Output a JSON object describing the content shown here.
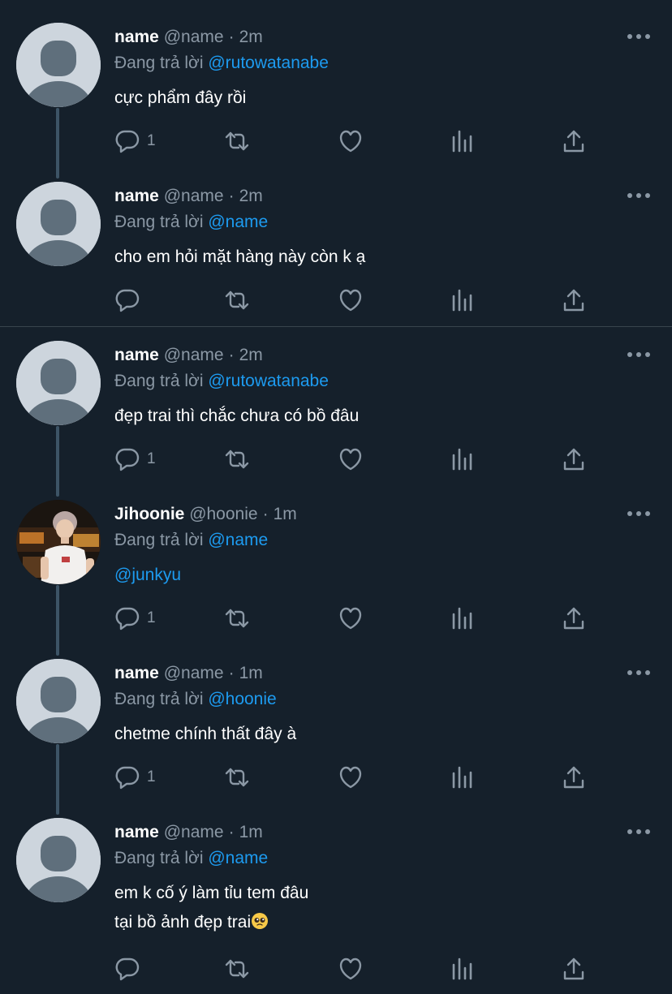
{
  "colors": {
    "background": "#15202b",
    "accent": "#1d9bf0",
    "muted": "#8b98a5",
    "thread_line": "#3d5466"
  },
  "icons": [
    "reply-icon",
    "retweet-icon",
    "like-icon",
    "analytics-icon",
    "share-icon",
    "more-icon"
  ],
  "tweets": [
    {
      "name": "name",
      "handle": "@name",
      "sep": "·",
      "time": "2m",
      "reply_prefix": "Đang trả lời",
      "reply_to": "@rutowatanabe",
      "text": "cực phẩm đây rồi",
      "reply_count": "1"
    },
    {
      "name": "name",
      "handle": "@name",
      "sep": "·",
      "time": "2m",
      "reply_prefix": "Đang trả lời",
      "reply_to": "@name",
      "text": "cho em hỏi mặt hàng này còn k ạ",
      "reply_count": ""
    },
    {
      "name": "name",
      "handle": "@name",
      "sep": "·",
      "time": "2m",
      "reply_prefix": "Đang trả lời",
      "reply_to": "@rutowatanabe",
      "text": "đẹp trai thì chắc chưa có bồ đâu",
      "reply_count": "1"
    },
    {
      "name": "Jihoonie",
      "handle": "@hoonie",
      "sep": "·",
      "time": "1m",
      "reply_prefix": "Đang trả lời",
      "reply_to": "@name",
      "text": "@junkyu",
      "reply_count": "1"
    },
    {
      "name": "name",
      "handle": "@name",
      "sep": "·",
      "time": "1m",
      "reply_prefix": "Đang trả lời",
      "reply_to": "@hoonie",
      "text": "chetme chính thất đây à",
      "reply_count": "1"
    },
    {
      "name": "name",
      "handle": "@name",
      "sep": "·",
      "time": "1m",
      "reply_prefix": "Đang trả lời",
      "reply_to": "@name",
      "text": "em k cố ý làm tỉu tem đâu\ntại bồ ảnh đẹp trai",
      "reply_count": ""
    }
  ]
}
